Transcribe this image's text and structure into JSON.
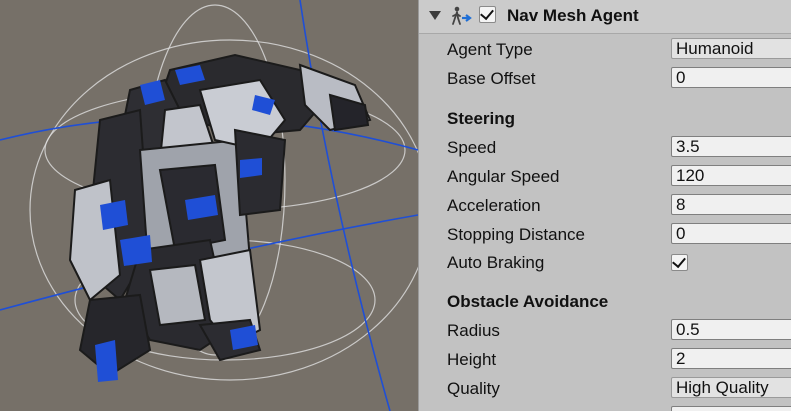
{
  "component": {
    "title": "Nav Mesh Agent",
    "icon": "nav-mesh-agent-icon",
    "enabled": true
  },
  "fields": {
    "agent_type": {
      "label": "Agent Type",
      "value": "Humanoid"
    },
    "base_offset": {
      "label": "Base Offset",
      "value": "0"
    }
  },
  "steering": {
    "heading": "Steering",
    "speed": {
      "label": "Speed",
      "value": "3.5"
    },
    "angular_speed": {
      "label": "Angular Speed",
      "value": "120"
    },
    "acceleration": {
      "label": "Acceleration",
      "value": "8"
    },
    "stopping_distance": {
      "label": "Stopping Distance",
      "value": "0"
    },
    "auto_braking": {
      "label": "Auto Braking",
      "checked": true
    }
  },
  "obstacle": {
    "heading": "Obstacle Avoidance",
    "radius": {
      "label": "Radius",
      "value": "0.5"
    },
    "height": {
      "label": "Height",
      "value": "2"
    },
    "quality": {
      "label": "Quality",
      "value": "High Quality"
    }
  },
  "colors": {
    "scene_bg": "#767068",
    "robot_accent": "#1f4fd6",
    "gizmo_wire": "#e0e0e0",
    "inspector_bg": "#c2c2c2"
  }
}
